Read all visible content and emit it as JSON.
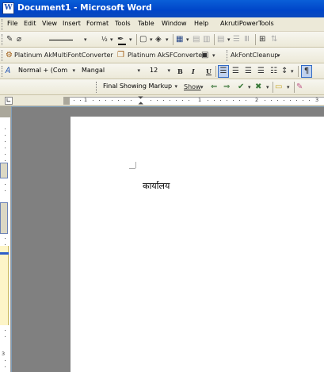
{
  "window": {
    "title": "Document1 - Microsoft Word",
    "icon": "W"
  },
  "menu": {
    "items": [
      "File",
      "Edit",
      "View",
      "Insert",
      "Format",
      "Tools",
      "Table",
      "Window",
      "Help",
      "AkrutiPowerTools"
    ]
  },
  "toolbar1": {
    "line_weight": "½"
  },
  "toolbar2": {
    "akmulti_label": "Platinum AkMultiFontConverter",
    "aksf_label": "Platinum AkSFConverter",
    "akfont_label": "AkFontCleanup"
  },
  "formatting": {
    "style": "Normal + (Com",
    "font": "Mangal",
    "size": "12",
    "bold": "B",
    "italic": "I",
    "underline": "U"
  },
  "reviewing": {
    "display": "Final Showing Markup",
    "show_label": "Show"
  },
  "ruler": {
    "numbers": [
      "1",
      "1",
      "2",
      "3"
    ]
  },
  "vruler": {
    "numbers": [
      "1",
      "2",
      "3"
    ]
  },
  "document": {
    "text": "कार्यालय"
  }
}
